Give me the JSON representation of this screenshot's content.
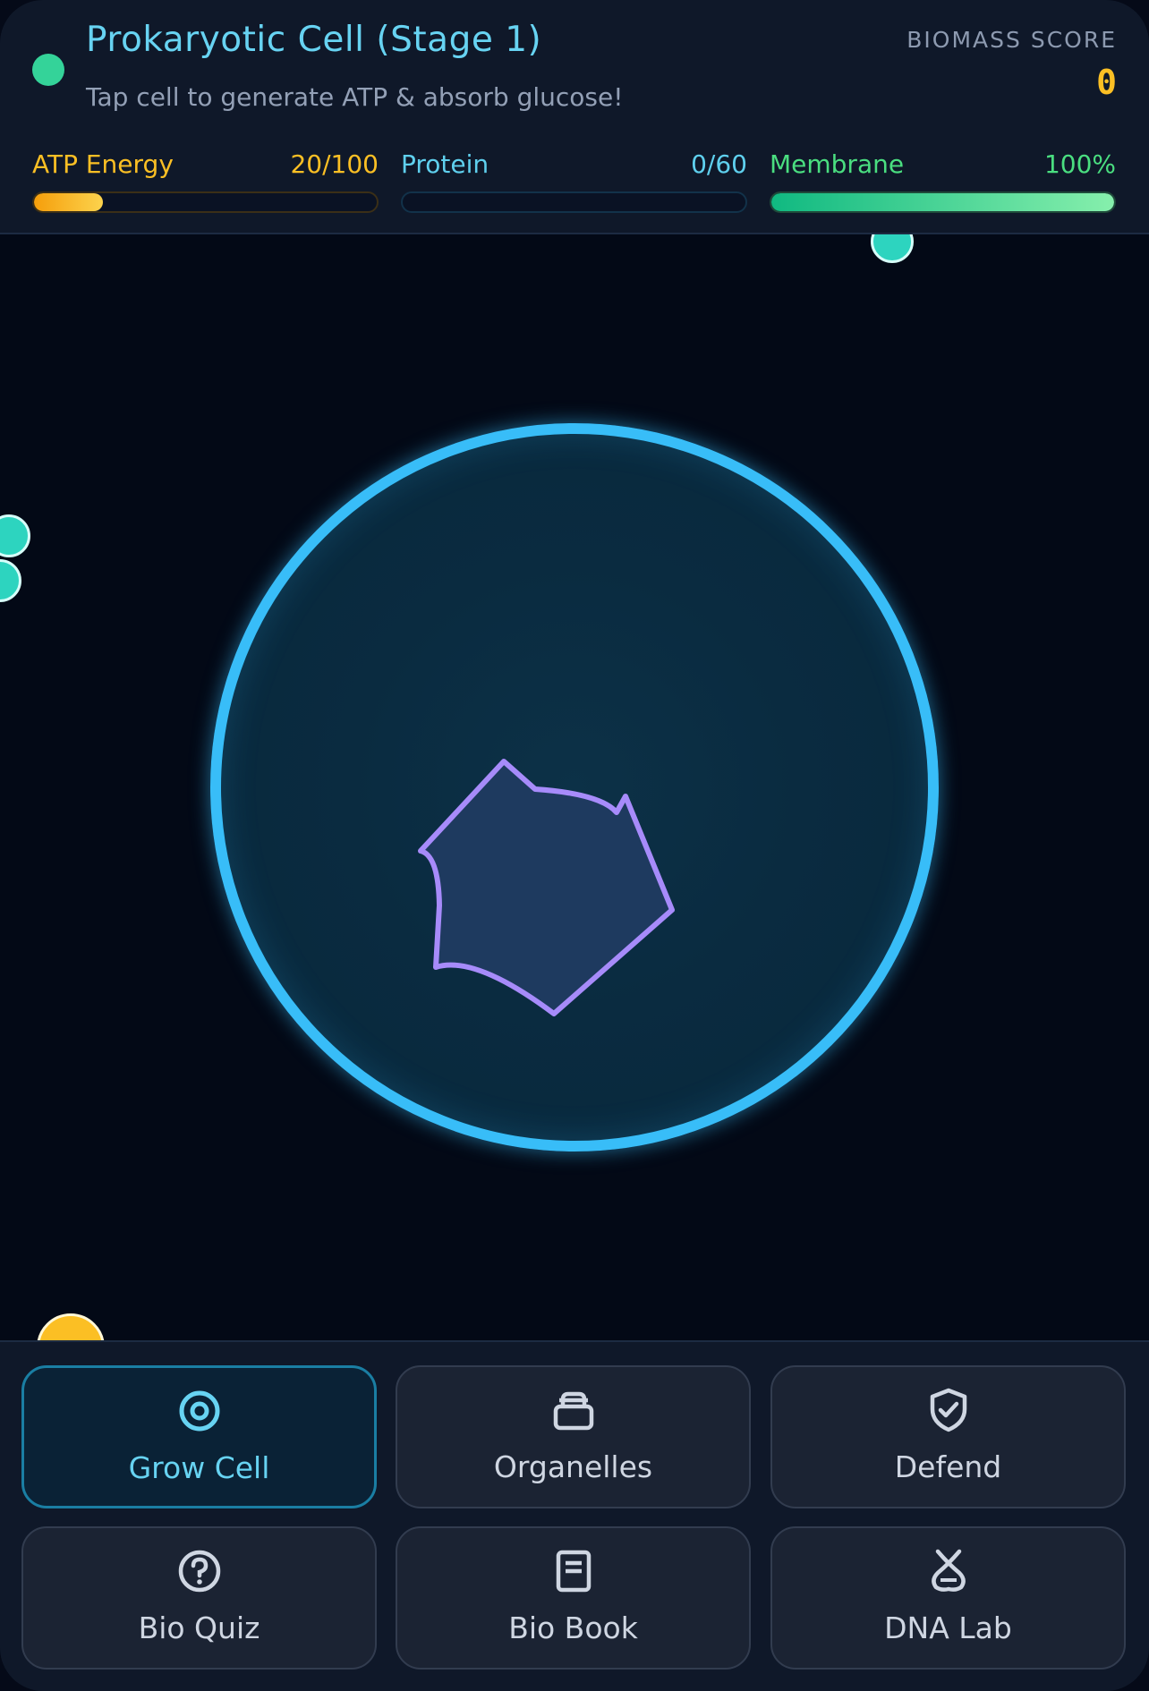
{
  "header": {
    "title": "Prokaryotic Cell (Stage 1)",
    "subtitle": "Tap cell to generate ATP & absorb glucose!",
    "score_label": "BIOMASS SCORE",
    "score_value": "0"
  },
  "meters": {
    "atp": {
      "label": "ATP Energy",
      "value_text": "20/100",
      "fraction": 0.2,
      "color": "#fbbf24"
    },
    "protein": {
      "label": "Protein",
      "value_text": "0/60",
      "fraction": 0,
      "color": "#5fd0ee"
    },
    "membrane": {
      "label": "Membrane",
      "value_text": "100%",
      "fraction": 1,
      "color": "#4ade80"
    }
  },
  "colors": {
    "cell_membrane": "#38bdf8",
    "nucleoid": "#a78bfa",
    "glucose": "#2dd4bf",
    "atp_orb": "#fbbf24",
    "accent": "#67d3f2"
  },
  "menu": {
    "grow": {
      "label": "Grow Cell",
      "icon": "target-icon",
      "active": true
    },
    "organelles": {
      "label": "Organelles",
      "icon": "briefcase-icon"
    },
    "defend": {
      "label": "Defend",
      "icon": "shield-check-icon"
    },
    "quiz": {
      "label": "Bio Quiz",
      "icon": "question-circle-icon"
    },
    "book": {
      "label": "Bio Book",
      "icon": "book-icon"
    },
    "dna": {
      "label": "DNA Lab",
      "icon": "dna-icon"
    }
  }
}
